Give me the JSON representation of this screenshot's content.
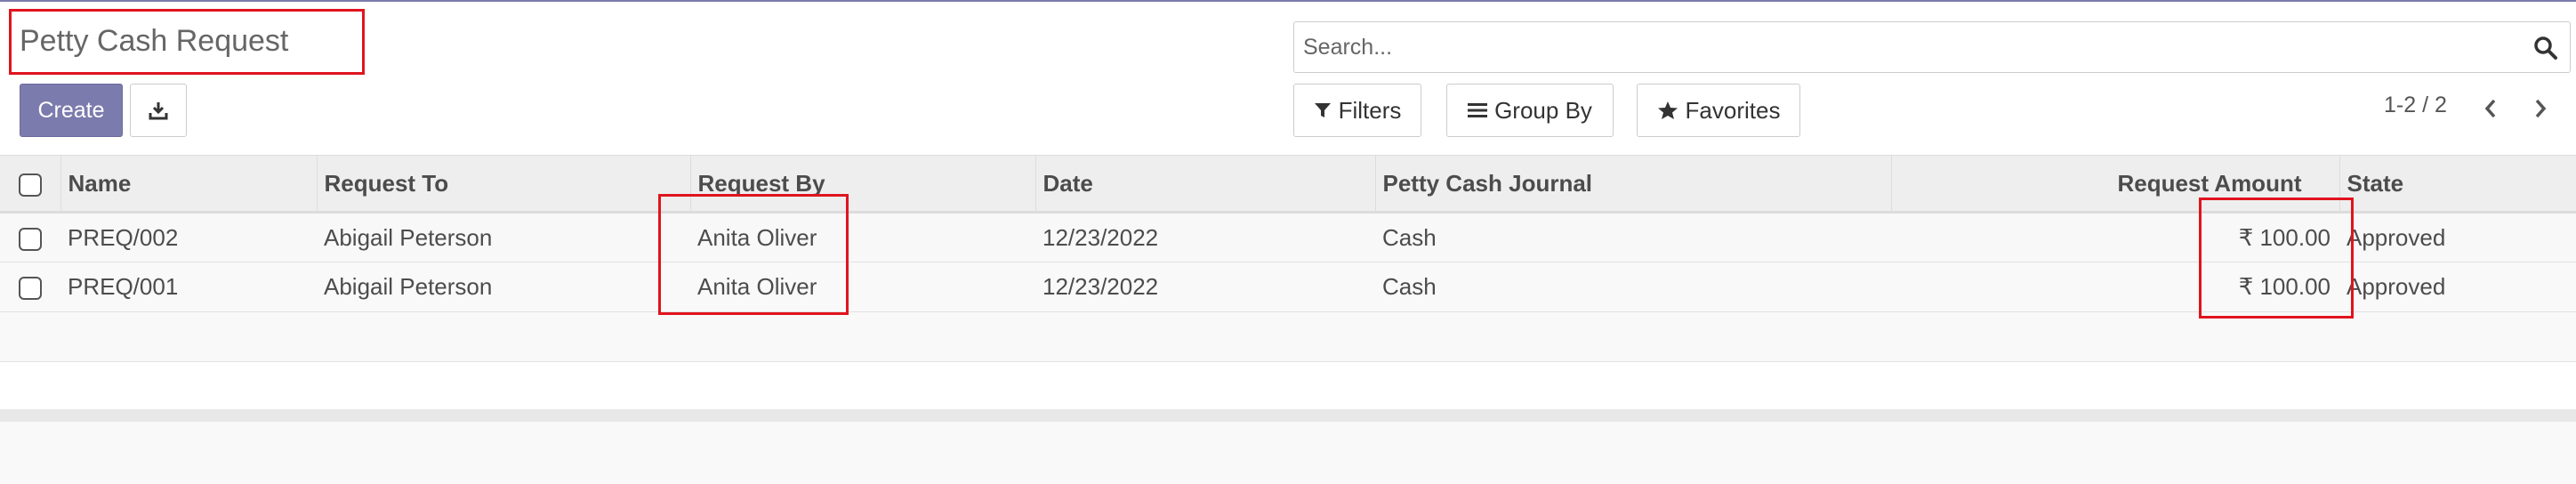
{
  "page": {
    "title": "Petty Cash Request"
  },
  "buttons": {
    "create": "Create",
    "download_icon": "download-icon"
  },
  "search": {
    "placeholder": "Search...",
    "icon": "search-icon"
  },
  "filters": {
    "filters_label": "Filters",
    "groupby_label": "Group By",
    "favorites_label": "Favorites"
  },
  "pager": {
    "value": "1-2 / 2"
  },
  "table": {
    "columns": {
      "name": "Name",
      "request_to": "Request To",
      "request_by": "Request By",
      "date": "Date",
      "journal": "Petty Cash Journal",
      "amount": "Request Amount",
      "state": "State"
    },
    "rows": [
      {
        "name": "PREQ/002",
        "request_to": "Abigail Peterson",
        "request_by": "Anita Oliver",
        "date": "12/23/2022",
        "journal": "Cash",
        "amount": "₹ 100.00",
        "state": "Approved"
      },
      {
        "name": "PREQ/001",
        "request_to": "Abigail Peterson",
        "request_by": "Anita Oliver",
        "date": "12/23/2022",
        "journal": "Cash",
        "amount": "₹ 100.00",
        "state": "Approved"
      }
    ]
  },
  "colors": {
    "brand": "#7c7bad",
    "highlight": "#e0141e"
  }
}
